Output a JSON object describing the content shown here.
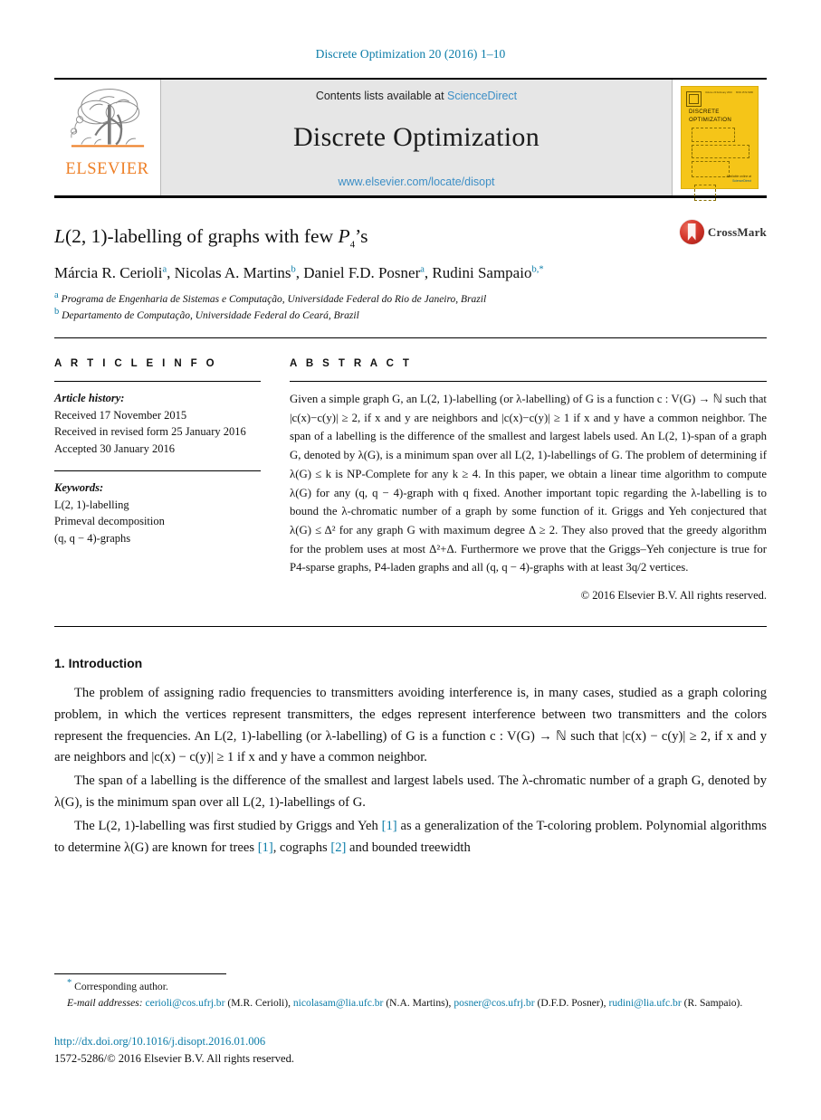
{
  "running_head": "Discrete Optimization 20 (2016) 1–10",
  "masthead": {
    "publisher_name": "ELSEVIER",
    "contents_prefix": "Contents lists available at ",
    "sciencedirect": "ScienceDirect",
    "journal_title": "Discrete Optimization",
    "journal_url": "www.elsevier.com/locate/disopt",
    "cover": {
      "title_line1": "DISCRETE",
      "title_line2": "OPTIMIZATION",
      "meta_left": "Volume 20  February 2016",
      "meta_right": "ISSN 1572-5286",
      "footer_line1": "Available online at",
      "footer_line2": "ScienceDirect"
    }
  },
  "article": {
    "title": "L(2, 1)-labelling of graphs with few P4's",
    "crossmark_label": "CrossMark",
    "authors": "Márcia R. Cerioli, Nicolas A. Martins, Daniel F.D. Posner, Rudini Sampaio",
    "author_marks": [
      "a",
      "b",
      "a",
      "b,*"
    ],
    "affiliations": [
      {
        "mark": "a",
        "text": "Programa de Engenharia de Sistemas e Computação, Universidade Federal do Rio de Janeiro, Brazil"
      },
      {
        "mark": "b",
        "text": "Departamento de Computação, Universidade Federal do Ceará, Brazil"
      }
    ]
  },
  "article_info": {
    "heading": "A R T I C L E   I N F O",
    "history_label": "Article history:",
    "history": [
      "Received 17 November 2015",
      "Received in revised form 25 January 2016",
      "Accepted 30 January 2016"
    ],
    "keywords_label": "Keywords:",
    "keywords": [
      "L(2, 1)-labelling",
      "Primeval decomposition",
      "(q, q − 4)-graphs"
    ]
  },
  "abstract": {
    "heading": "A B S T R A C T",
    "text": "Given a simple graph G, an L(2, 1)-labelling (or λ-labelling) of G is a function c : V(G) → ℕ such that |c(x)−c(y)| ≥ 2, if x and y are neighbors and |c(x)−c(y)| ≥ 1 if x and y have a common neighbor. The span of a labelling is the difference of the smallest and largest labels used. An L(2, 1)-span of a graph G, denoted by λ(G), is a minimum span over all L(2, 1)-labellings of G. The problem of determining if λ(G) ≤ k is NP-Complete for any k ≥ 4. In this paper, we obtain a linear time algorithm to compute λ(G) for any (q, q − 4)-graph with q fixed. Another important topic regarding the λ-labelling is to bound the λ-chromatic number of a graph by some function of it. Griggs and Yeh conjectured that λ(G) ≤ Δ² for any graph G with maximum degree Δ ≥ 2. They also proved that the greedy algorithm for the problem uses at most Δ²+Δ. Furthermore we prove that the Griggs–Yeh conjecture is true for P4-sparse graphs, P4-laden graphs and all (q, q − 4)-graphs with at least 3q/2 vertices.",
    "copyright": "© 2016 Elsevier B.V. All rights reserved."
  },
  "section": {
    "number_title": "1. Introduction",
    "paragraphs": [
      "The problem of assigning radio frequencies to transmitters avoiding interference is, in many cases, studied as a graph coloring problem, in which the vertices represent transmitters, the edges represent interference between two transmitters and the colors represent the frequencies. An L(2, 1)-labelling (or λ-labelling) of G is a function c : V(G) → ℕ such that |c(x) − c(y)| ≥ 2, if x and y are neighbors and |c(x) − c(y)| ≥ 1 if x and y have a common neighbor.",
      "The span of a labelling is the difference of the smallest and largest labels used. The λ-chromatic number of a graph G, denoted by λ(G), is the minimum span over all L(2, 1)-labellings of G."
    ],
    "paragraph3_part1": "The L(2, 1)-labelling was first studied by Griggs and Yeh ",
    "paragraph3_cite1": "[1]",
    "paragraph3_part2": " as a generalization of the T-coloring problem. Polynomial algorithms to determine λ(G) are known for trees ",
    "paragraph3_cite2": "[1]",
    "paragraph3_part3": ", cographs ",
    "paragraph3_cite3": "[2]",
    "paragraph3_part4": " and bounded treewidth"
  },
  "footnotes": {
    "corresponding_mark": "*",
    "corresponding_text": "Corresponding author.",
    "emails_label": "E-mail addresses:",
    "emails": [
      {
        "address": "cerioli@cos.ufrj.br",
        "owner": "(M.R. Cerioli)"
      },
      {
        "address": "nicolasam@lia.ufc.br",
        "owner": "(N.A. Martins)"
      },
      {
        "address": "posner@cos.ufrj.br",
        "owner": "(D.F.D. Posner)"
      },
      {
        "address": "rudini@lia.ufc.br",
        "owner": "(R. Sampaio)"
      }
    ],
    "doi": "http://dx.doi.org/10.1016/j.disopt.2016.01.006",
    "issn_line": "1572-5286/© 2016 Elsevier B.V. All rights reserved."
  },
  "colors": {
    "link_blue": "#0b7ca8",
    "sciencedirect_blue": "#3d8fc6",
    "elsevier_orange": "#ee7f26",
    "cover_yellow": "#f5c518",
    "masthead_gray": "#e6e6e6"
  }
}
